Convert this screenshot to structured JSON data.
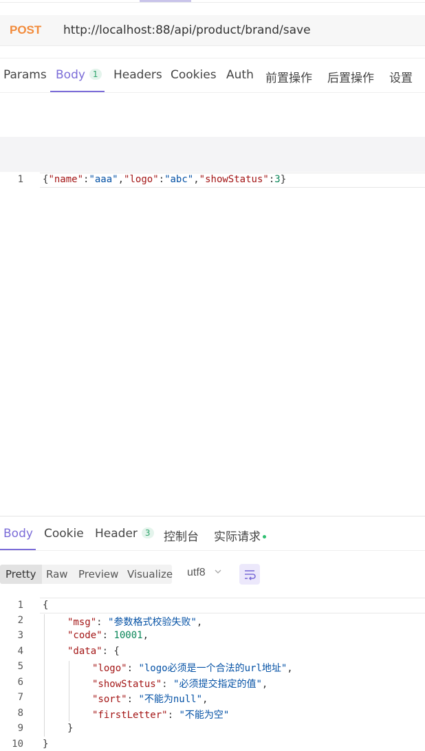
{
  "request": {
    "method": "POST",
    "url": "http://localhost:88/api/product/brand/save"
  },
  "request_tabs": [
    {
      "label": "Params"
    },
    {
      "label": "Body",
      "badge": "1",
      "active": true
    },
    {
      "label": "Headers"
    },
    {
      "label": "Cookies"
    },
    {
      "label": "Auth"
    },
    {
      "label": "前置操作"
    },
    {
      "label": "后置操作"
    },
    {
      "label": "设置"
    }
  ],
  "request_body": {
    "line_number": "1",
    "tokens": [
      "{",
      "\"name\"",
      ":",
      "\"aaa\"",
      ",",
      "\"logo\"",
      ":",
      "\"abc\"",
      ",",
      "\"showStatus\"",
      ":",
      "3",
      "}"
    ]
  },
  "response_tabs": [
    {
      "label": "Body",
      "active": true
    },
    {
      "label": "Cookie"
    },
    {
      "label": "Header",
      "badge": "3"
    },
    {
      "label": "控制台"
    },
    {
      "label": "实际请求",
      "dot": true
    }
  ],
  "format": {
    "buttons": [
      "Pretty",
      "Raw",
      "Preview",
      "Visualize"
    ],
    "active": "Pretty",
    "encoding": "utf8"
  },
  "response_body": {
    "line_numbers": [
      "1",
      "2",
      "3",
      "4",
      "5",
      "6",
      "7",
      "8",
      "9",
      "10"
    ],
    "open_brace": "{",
    "msg_key": "\"msg\"",
    "msg_val": "\"参数格式校验失败\"",
    "code_key": "\"code\"",
    "code_val": "10001",
    "data_key": "\"data\"",
    "logo_key": "\"logo\"",
    "logo_val": "\"logo必须是一个合法的url地址\"",
    "showStatus_key": "\"showStatus\"",
    "showStatus_val": "\"必须提交指定的值\"",
    "sort_key": "\"sort\"",
    "sort_val": "\"不能为null\"",
    "firstLetter_key": "\"firstLetter\"",
    "firstLetter_val": "\"不能为空\"",
    "inner_close": "}",
    "close_brace": "}"
  },
  "colors": {
    "accent": "#7b6cd8",
    "method": "#f28b3b",
    "json_key": "#a31515",
    "json_string": "#0451a5",
    "json_number": "#098658"
  }
}
